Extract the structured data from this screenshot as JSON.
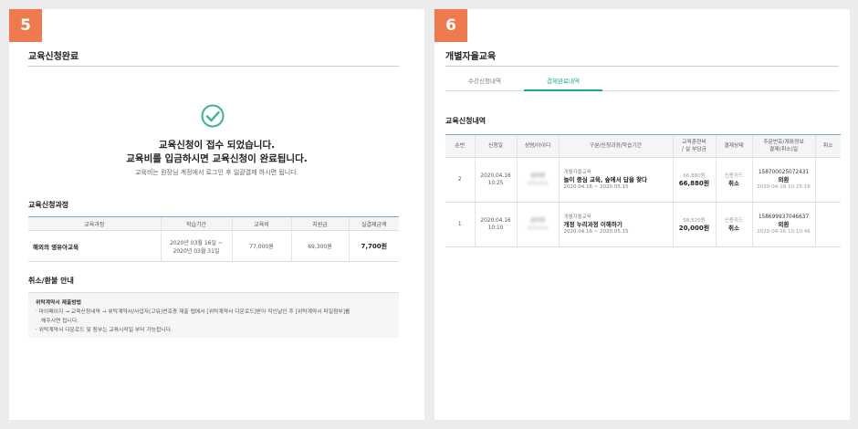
{
  "left": {
    "step": "5",
    "title": "교육신청완료",
    "message_line1": "교육신청이 접수 되었습니다.",
    "message_line2": "교육비를 입금하시면 교육신청이 완료됩니다.",
    "note": "교육비는 원장님 계정에서 로그인 후 일괄결제 하시면 됩니다.",
    "process_title": "교육신청과정",
    "table": {
      "headers": [
        "교육과정",
        "학습기간",
        "교육비",
        "지원금",
        "실결제금액"
      ],
      "row": {
        "course": "해외의 영유아교육",
        "period_line1": "2020년 03월 16일 ~",
        "period_line2": "2020년 03월 31일",
        "fee": "77,000원",
        "support": "69,300원",
        "actual": "7,700원"
      }
    },
    "refund_title": "취소/환불 안내",
    "refund_box": {
      "heading": "위탁계약서 제출방법",
      "line1": "· 마이페이지 → 교육신청내역 → 위탁계약서/사업자(고유)번호증 제출 탭에서 [위탁계약서 다운로드]받아 작인날인 후 [위탁계약서 파일첨부]를",
      "line2": "해주시면 됩니다.",
      "line3": "· 위탁계약서 다운로드 및 첨부는 교육시작일 부터 가능합니다."
    }
  },
  "right": {
    "step": "6",
    "title": "개별자율교육",
    "tabs": [
      "수강신청내역",
      "결제완료내역"
    ],
    "section_title": "교육신청내역",
    "headers": {
      "no": "순번",
      "date": "신청일",
      "name": "성명/아이디",
      "course": "구분/신청과정/학습기간",
      "fee_1": "교육훈련비",
      "fee_2": "/ 실 부담금",
      "status": "결제상태",
      "order_1": "주문번호/계좌정보",
      "order_2": "결제(취소)일",
      "cancel": "취소"
    },
    "rows": [
      {
        "no": "2",
        "date": "2020.04.16",
        "time": "10:25",
        "name": "김아영",
        "id": "ahyoung",
        "category": "개별자율교육",
        "course": "놀이 중심 교육, 숲에서 답을 찾다",
        "period": "2020.04.16 ~ 2020.05.15",
        "fee_orig": "66,880원",
        "fee_paid": "66,880원",
        "method": "신용카드",
        "state": "취소",
        "order_no": "158700025072431",
        "order_out": "외환",
        "order_time": "2020-04-16 10:25:18"
      },
      {
        "no": "1",
        "date": "2020.04.16",
        "time": "10:10",
        "name": "김아영",
        "id": "ahyoung",
        "category": "개별자율교육",
        "course": "개정 누리과정 이해하기",
        "period": "2020.04.16 ~ 2020.05.15",
        "fee_orig": "58,520원",
        "fee_paid": "20,000원",
        "method": "신용카드",
        "state": "취소",
        "order_no": "158699937046637",
        "order_out": "외환",
        "order_time": "2020-04-16 10:10:46"
      }
    ]
  },
  "colors": {
    "badge": "#f07a4f",
    "accent": "#1aa98d",
    "check": "#3ab39a"
  }
}
